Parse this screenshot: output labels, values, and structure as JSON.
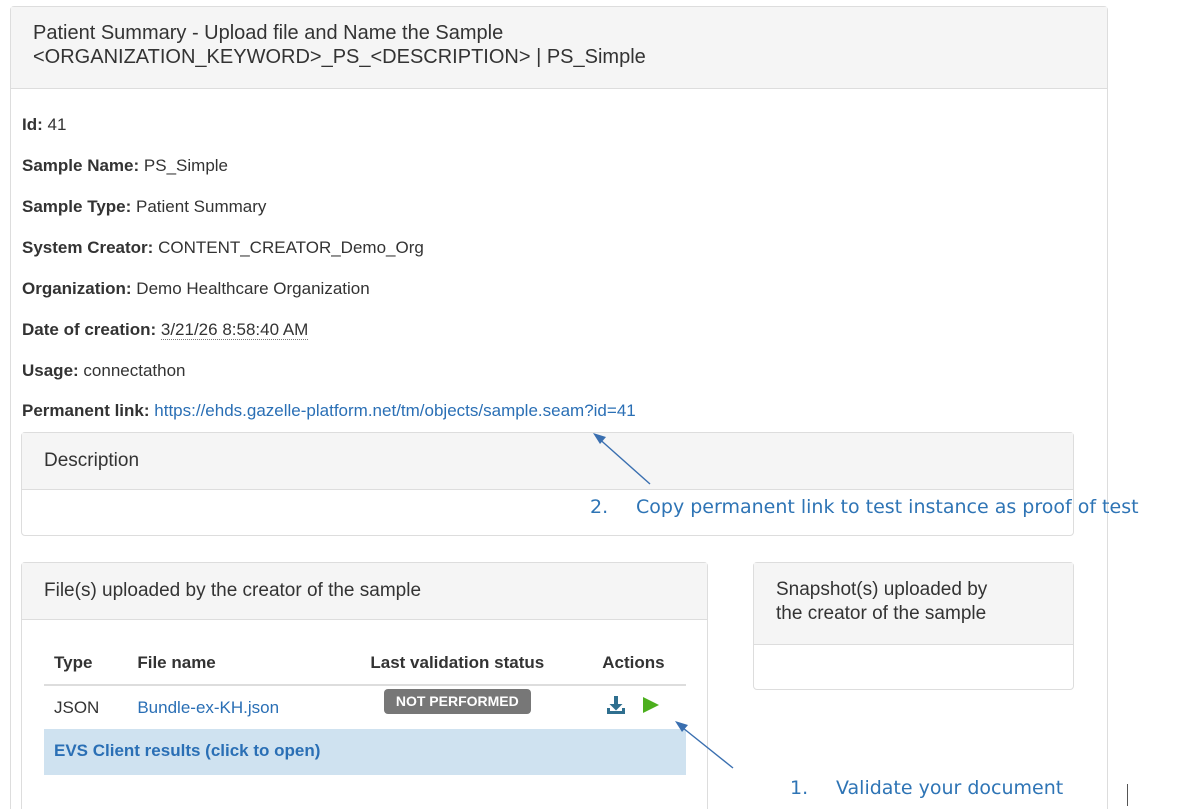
{
  "main": {
    "title_line1": "Patient Summary - Upload file and Name the Sample",
    "title_line2": "<ORGANIZATION_KEYWORD>_PS_<DESCRIPTION> | PS_Simple"
  },
  "info": {
    "id": {
      "label": "Id:",
      "value": "41"
    },
    "sample_name": {
      "label": "Sample Name:",
      "value": "PS_Simple"
    },
    "sample_type": {
      "label": "Sample Type:",
      "value": "Patient Summary"
    },
    "system_creator": {
      "label": "System Creator:",
      "value": "CONTENT_CREATOR_Demo_Org"
    },
    "organization": {
      "label": "Organization:",
      "value": "Demo Healthcare Organization"
    },
    "date_of_creation": {
      "label": "Date of creation:",
      "value": "3/21/26 8:58:40 AM"
    },
    "usage": {
      "label": "Usage:",
      "value": "connectathon"
    },
    "permanent_link": {
      "label": "Permanent link:",
      "value": "https://ehds.gazelle-platform.net/tm/objects/sample.seam?id=41"
    }
  },
  "description_panel": {
    "title": "Description"
  },
  "files_panel": {
    "title": "File(s) uploaded by the creator of the sample",
    "columns": [
      "Type",
      "File name",
      "Last validation status",
      "Actions"
    ],
    "rows": [
      {
        "type": "JSON",
        "file_name": "Bundle-ex-KH.json",
        "status": "NOT PERFORMED",
        "actions": [
          "download-icon",
          "play-icon"
        ]
      }
    ],
    "evs_link": "EVS Client results (click to open)"
  },
  "snapshot_panel": {
    "title_line1": "Snapshot(s) uploaded by",
    "title_line2": "the creator of the sample"
  },
  "annotations": [
    {
      "num": "1.",
      "text": "Validate your document"
    },
    {
      "num": "2.",
      "text": "Copy permanent link to test instance as proof of test"
    }
  ],
  "colors": {
    "link": "#2a6fb5",
    "annotation": "#2e74b5",
    "badge": "#777777",
    "evs_row_bg": "#cfe2f0",
    "download_icon": "#2f6f8f",
    "play_icon": "#4caf1e"
  }
}
